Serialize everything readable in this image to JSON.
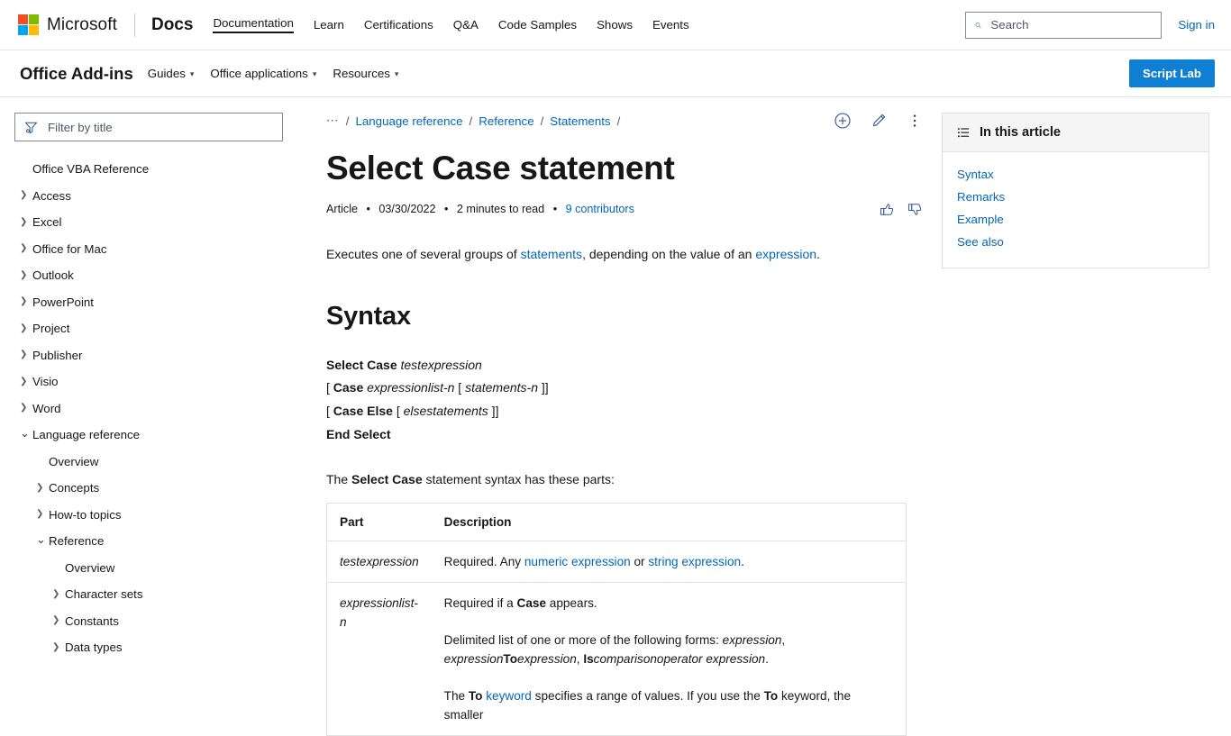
{
  "header": {
    "brand": "Microsoft",
    "product": "Docs",
    "nav": [
      {
        "label": "Documentation",
        "active": true
      },
      {
        "label": "Learn",
        "active": false
      },
      {
        "label": "Certifications",
        "active": false
      },
      {
        "label": "Q&A",
        "active": false
      },
      {
        "label": "Code Samples",
        "active": false
      },
      {
        "label": "Shows",
        "active": false
      },
      {
        "label": "Events",
        "active": false
      }
    ],
    "search": {
      "placeholder": "Search",
      "value": ""
    },
    "signin": "Sign in",
    "logo_colors": [
      "#f25022",
      "#7fba00",
      "#00a4ef",
      "#ffb900"
    ]
  },
  "subheader": {
    "title": "Office Add-ins",
    "nav": [
      {
        "label": "Guides"
      },
      {
        "label": "Office applications"
      },
      {
        "label": "Resources"
      }
    ],
    "action_button": "Script Lab",
    "accent": "#0f7fd4"
  },
  "sidebar": {
    "filter": {
      "placeholder": "Filter by title",
      "value": ""
    },
    "items": [
      {
        "label": "Office VBA Reference",
        "indent": 0,
        "arrow": "none"
      },
      {
        "label": "Access",
        "indent": 0,
        "arrow": "collapsed"
      },
      {
        "label": "Excel",
        "indent": 0,
        "arrow": "collapsed"
      },
      {
        "label": "Office for Mac",
        "indent": 0,
        "arrow": "collapsed"
      },
      {
        "label": "Outlook",
        "indent": 0,
        "arrow": "collapsed"
      },
      {
        "label": "PowerPoint",
        "indent": 0,
        "arrow": "collapsed"
      },
      {
        "label": "Project",
        "indent": 0,
        "arrow": "collapsed"
      },
      {
        "label": "Publisher",
        "indent": 0,
        "arrow": "collapsed"
      },
      {
        "label": "Visio",
        "indent": 0,
        "arrow": "collapsed"
      },
      {
        "label": "Word",
        "indent": 0,
        "arrow": "collapsed"
      },
      {
        "label": "Language reference",
        "indent": 0,
        "arrow": "expanded"
      },
      {
        "label": "Overview",
        "indent": 1,
        "arrow": "none"
      },
      {
        "label": "Concepts",
        "indent": 1,
        "arrow": "collapsed"
      },
      {
        "label": "How-to topics",
        "indent": 1,
        "arrow": "collapsed"
      },
      {
        "label": "Reference",
        "indent": 1,
        "arrow": "expanded"
      },
      {
        "label": "Overview",
        "indent": 2,
        "arrow": "none"
      },
      {
        "label": "Character sets",
        "indent": 2,
        "arrow": "collapsed"
      },
      {
        "label": "Constants",
        "indent": 2,
        "arrow": "collapsed"
      },
      {
        "label": "Data types",
        "indent": 2,
        "arrow": "collapsed"
      }
    ]
  },
  "article": {
    "breadcrumb": {
      "overflow": "⋯",
      "items": [
        "Language reference",
        "Reference",
        "Statements"
      ],
      "separator": "/"
    },
    "actions": [
      "add-to-collection-icon",
      "edit-icon",
      "more-options-icon"
    ],
    "title": "Select Case statement",
    "meta": {
      "type": "Article",
      "date": "03/30/2022",
      "read_time": "2 minutes to read",
      "contributors": "9 contributors",
      "separator": "•"
    },
    "feedback": [
      "thumbs-up-icon",
      "thumbs-down-icon"
    ],
    "intro": {
      "part1": "Executes one of several groups of ",
      "link1": "statements",
      "part2": ", depending on the value of an ",
      "link2": "expression",
      "part3": "."
    },
    "syntax_heading": "Syntax",
    "syntax_lines": [
      {
        "bold1": "Select Case",
        "italic1": "testexpression"
      },
      {
        "pre": "[ ",
        "bold1": "Case",
        "italic1": "expressionlist-n",
        "mid": "[ ",
        "italic2": "statements-n",
        "post": "]]"
      },
      {
        "pre": "[ ",
        "bold1": "Case Else",
        "mid": "[ ",
        "italic2": "elsestatements",
        "post": "]]"
      },
      {
        "bold1": "End Select"
      }
    ],
    "parts_lead": {
      "pre": "The ",
      "bold": "Select Case",
      "post": " statement syntax has these parts:"
    },
    "table": {
      "headers": [
        "Part",
        "Description"
      ],
      "rows": [
        {
          "part": "testexpression",
          "desc_segments": [
            [
              {
                "t": "Required. Any ",
                "s": "plain"
              },
              {
                "t": "numeric expression",
                "s": "link"
              },
              {
                "t": " or ",
                "s": "plain"
              },
              {
                "t": "string expression",
                "s": "link"
              },
              {
                "t": ".",
                "s": "plain"
              }
            ]
          ]
        },
        {
          "part": "expressionlist-n",
          "desc_segments": [
            [
              {
                "t": "Required if a ",
                "s": "plain"
              },
              {
                "t": "Case",
                "s": "bold"
              },
              {
                "t": " appears.",
                "s": "plain"
              }
            ],
            [
              {
                "t": "Delimited list of one or more of the following forms: ",
                "s": "plain"
              },
              {
                "t": "expression",
                "s": "italic"
              },
              {
                "t": ", ",
                "s": "plain"
              },
              {
                "t": "expression",
                "s": "italic"
              },
              {
                "t": "To",
                "s": "bold"
              },
              {
                "t": "expression",
                "s": "italic"
              },
              {
                "t": ", ",
                "s": "plain"
              },
              {
                "t": "Is",
                "s": "bold"
              },
              {
                "t": "comparisonoperator",
                "s": "italic"
              },
              {
                "t": " ",
                "s": "plain"
              },
              {
                "t": "expression",
                "s": "italic"
              },
              {
                "t": ".",
                "s": "plain"
              }
            ],
            [
              {
                "t": "The ",
                "s": "plain"
              },
              {
                "t": "To",
                "s": "bold"
              },
              {
                "t": " ",
                "s": "plain"
              },
              {
                "t": "keyword",
                "s": "link"
              },
              {
                "t": " specifies a range of values. If you use the ",
                "s": "plain"
              },
              {
                "t": "To",
                "s": "bold"
              },
              {
                "t": " keyword, the smaller",
                "s": "plain"
              }
            ]
          ]
        }
      ]
    }
  },
  "rail": {
    "heading": "In this article",
    "links": [
      "Syntax",
      "Remarks",
      "Example",
      "See also"
    ]
  }
}
